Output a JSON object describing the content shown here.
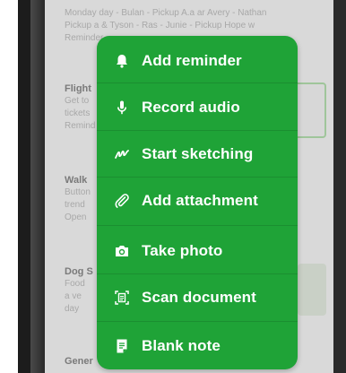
{
  "background_notes": [
    {
      "title": "",
      "lines": [
        "Monday day - Bulan - Pickup A.a ar Avery - Nathan",
        "Pickup a & Tyson - Ras - Junie - Pickup Hope w",
        "Reminder"
      ]
    },
    {
      "title": "Flight",
      "lines": [
        "Get to",
        "tickets",
        "Remind"
      ]
    },
    {
      "title": "Walk",
      "lines": [
        "Button",
        "trend",
        "Open"
      ]
    },
    {
      "title": "Dog S",
      "lines": [
        "Food",
        "a ve",
        "day"
      ]
    },
    {
      "title": "Gener",
      "lines": []
    }
  ],
  "menu": {
    "items": [
      {
        "id": "add-reminder",
        "label": "Add reminder",
        "icon": "bell-icon"
      },
      {
        "id": "record-audio",
        "label": "Record audio",
        "icon": "microphone-icon"
      },
      {
        "id": "start-sketching",
        "label": "Start sketching",
        "icon": "scribble-icon"
      },
      {
        "id": "add-attachment",
        "label": "Add attachment",
        "icon": "paperclip-icon"
      },
      {
        "id": "take-photo",
        "label": "Take photo",
        "icon": "camera-icon"
      },
      {
        "id": "scan-document",
        "label": "Scan document",
        "icon": "scan-icon"
      },
      {
        "id": "blank-note",
        "label": "Blank note",
        "icon": "note-icon"
      }
    ]
  },
  "colors": {
    "menu_background": "#1fa337",
    "menu_text": "#ffffff",
    "screen_dim": "#d9d9d9"
  }
}
